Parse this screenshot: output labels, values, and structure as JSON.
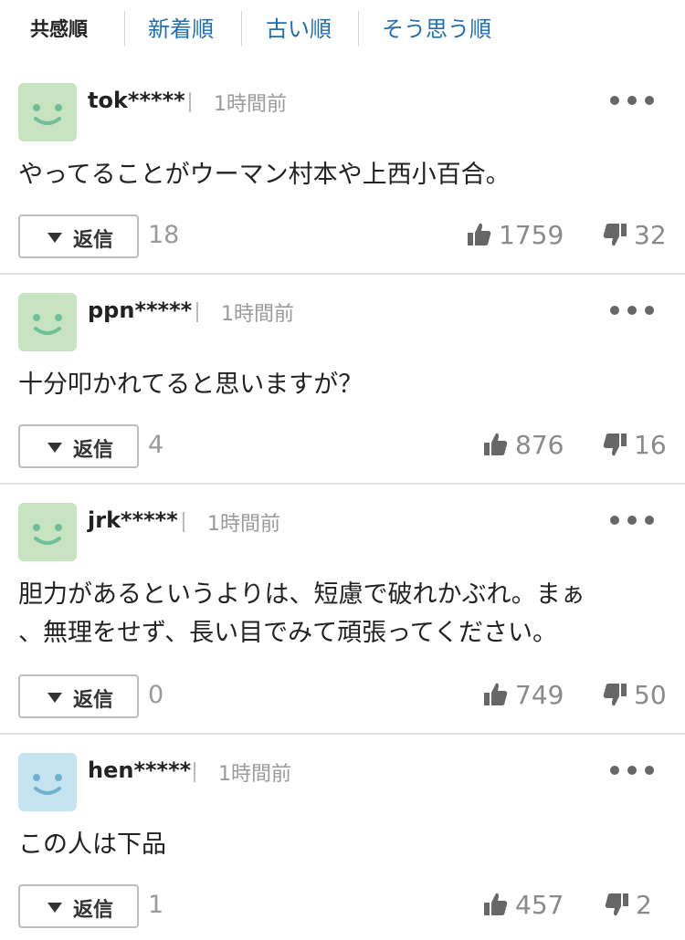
{
  "colors": {
    "accent_link": "#1f6fb5",
    "avatar_green": "#c8e3bf",
    "avatar_green_face": "#6fbf9a",
    "avatar_blue": "#c6e3f0",
    "avatar_blue_face": "#6fb3d2",
    "divider": "#e3e3e3"
  },
  "sort_tabs": [
    {
      "label": "共感順",
      "active": true
    },
    {
      "label": "新着順",
      "active": false
    },
    {
      "label": "古い順",
      "active": false
    },
    {
      "label": "そう思う順",
      "active": false
    }
  ],
  "comments": [
    {
      "username": "tok*****",
      "timestamp": "1時間前",
      "avatar_icon": "smiley-face-icon",
      "avatar_color": "green",
      "text": "やってることがウーマン村本や上西小百合。",
      "reply_label": "返信",
      "reply_count": "18",
      "likes": "1759",
      "dislikes": "32"
    },
    {
      "username": "ppn*****",
      "timestamp": "1時間前",
      "avatar_icon": "smiley-face-icon",
      "avatar_color": "green",
      "text": "十分叩かれてると思いますが？",
      "reply_label": "返信",
      "reply_count": "4",
      "likes": "876",
      "dislikes": "16"
    },
    {
      "username": "jrk*****",
      "timestamp": "1時間前",
      "avatar_icon": "smiley-face-icon",
      "avatar_color": "green",
      "text": "胆力があるというよりは、短慮で破れかぶれ。まぁ\n、無理をせず、長い目でみて頑張ってください。",
      "reply_label": "返信",
      "reply_count": "0",
      "likes": "749",
      "dislikes": "50"
    },
    {
      "username": "hen*****",
      "timestamp": "1時間前",
      "avatar_icon": "smiley-face-icon",
      "avatar_color": "blue",
      "text": "この人は下品",
      "reply_label": "返信",
      "reply_count": "1",
      "likes": "457",
      "dislikes": "2"
    }
  ]
}
